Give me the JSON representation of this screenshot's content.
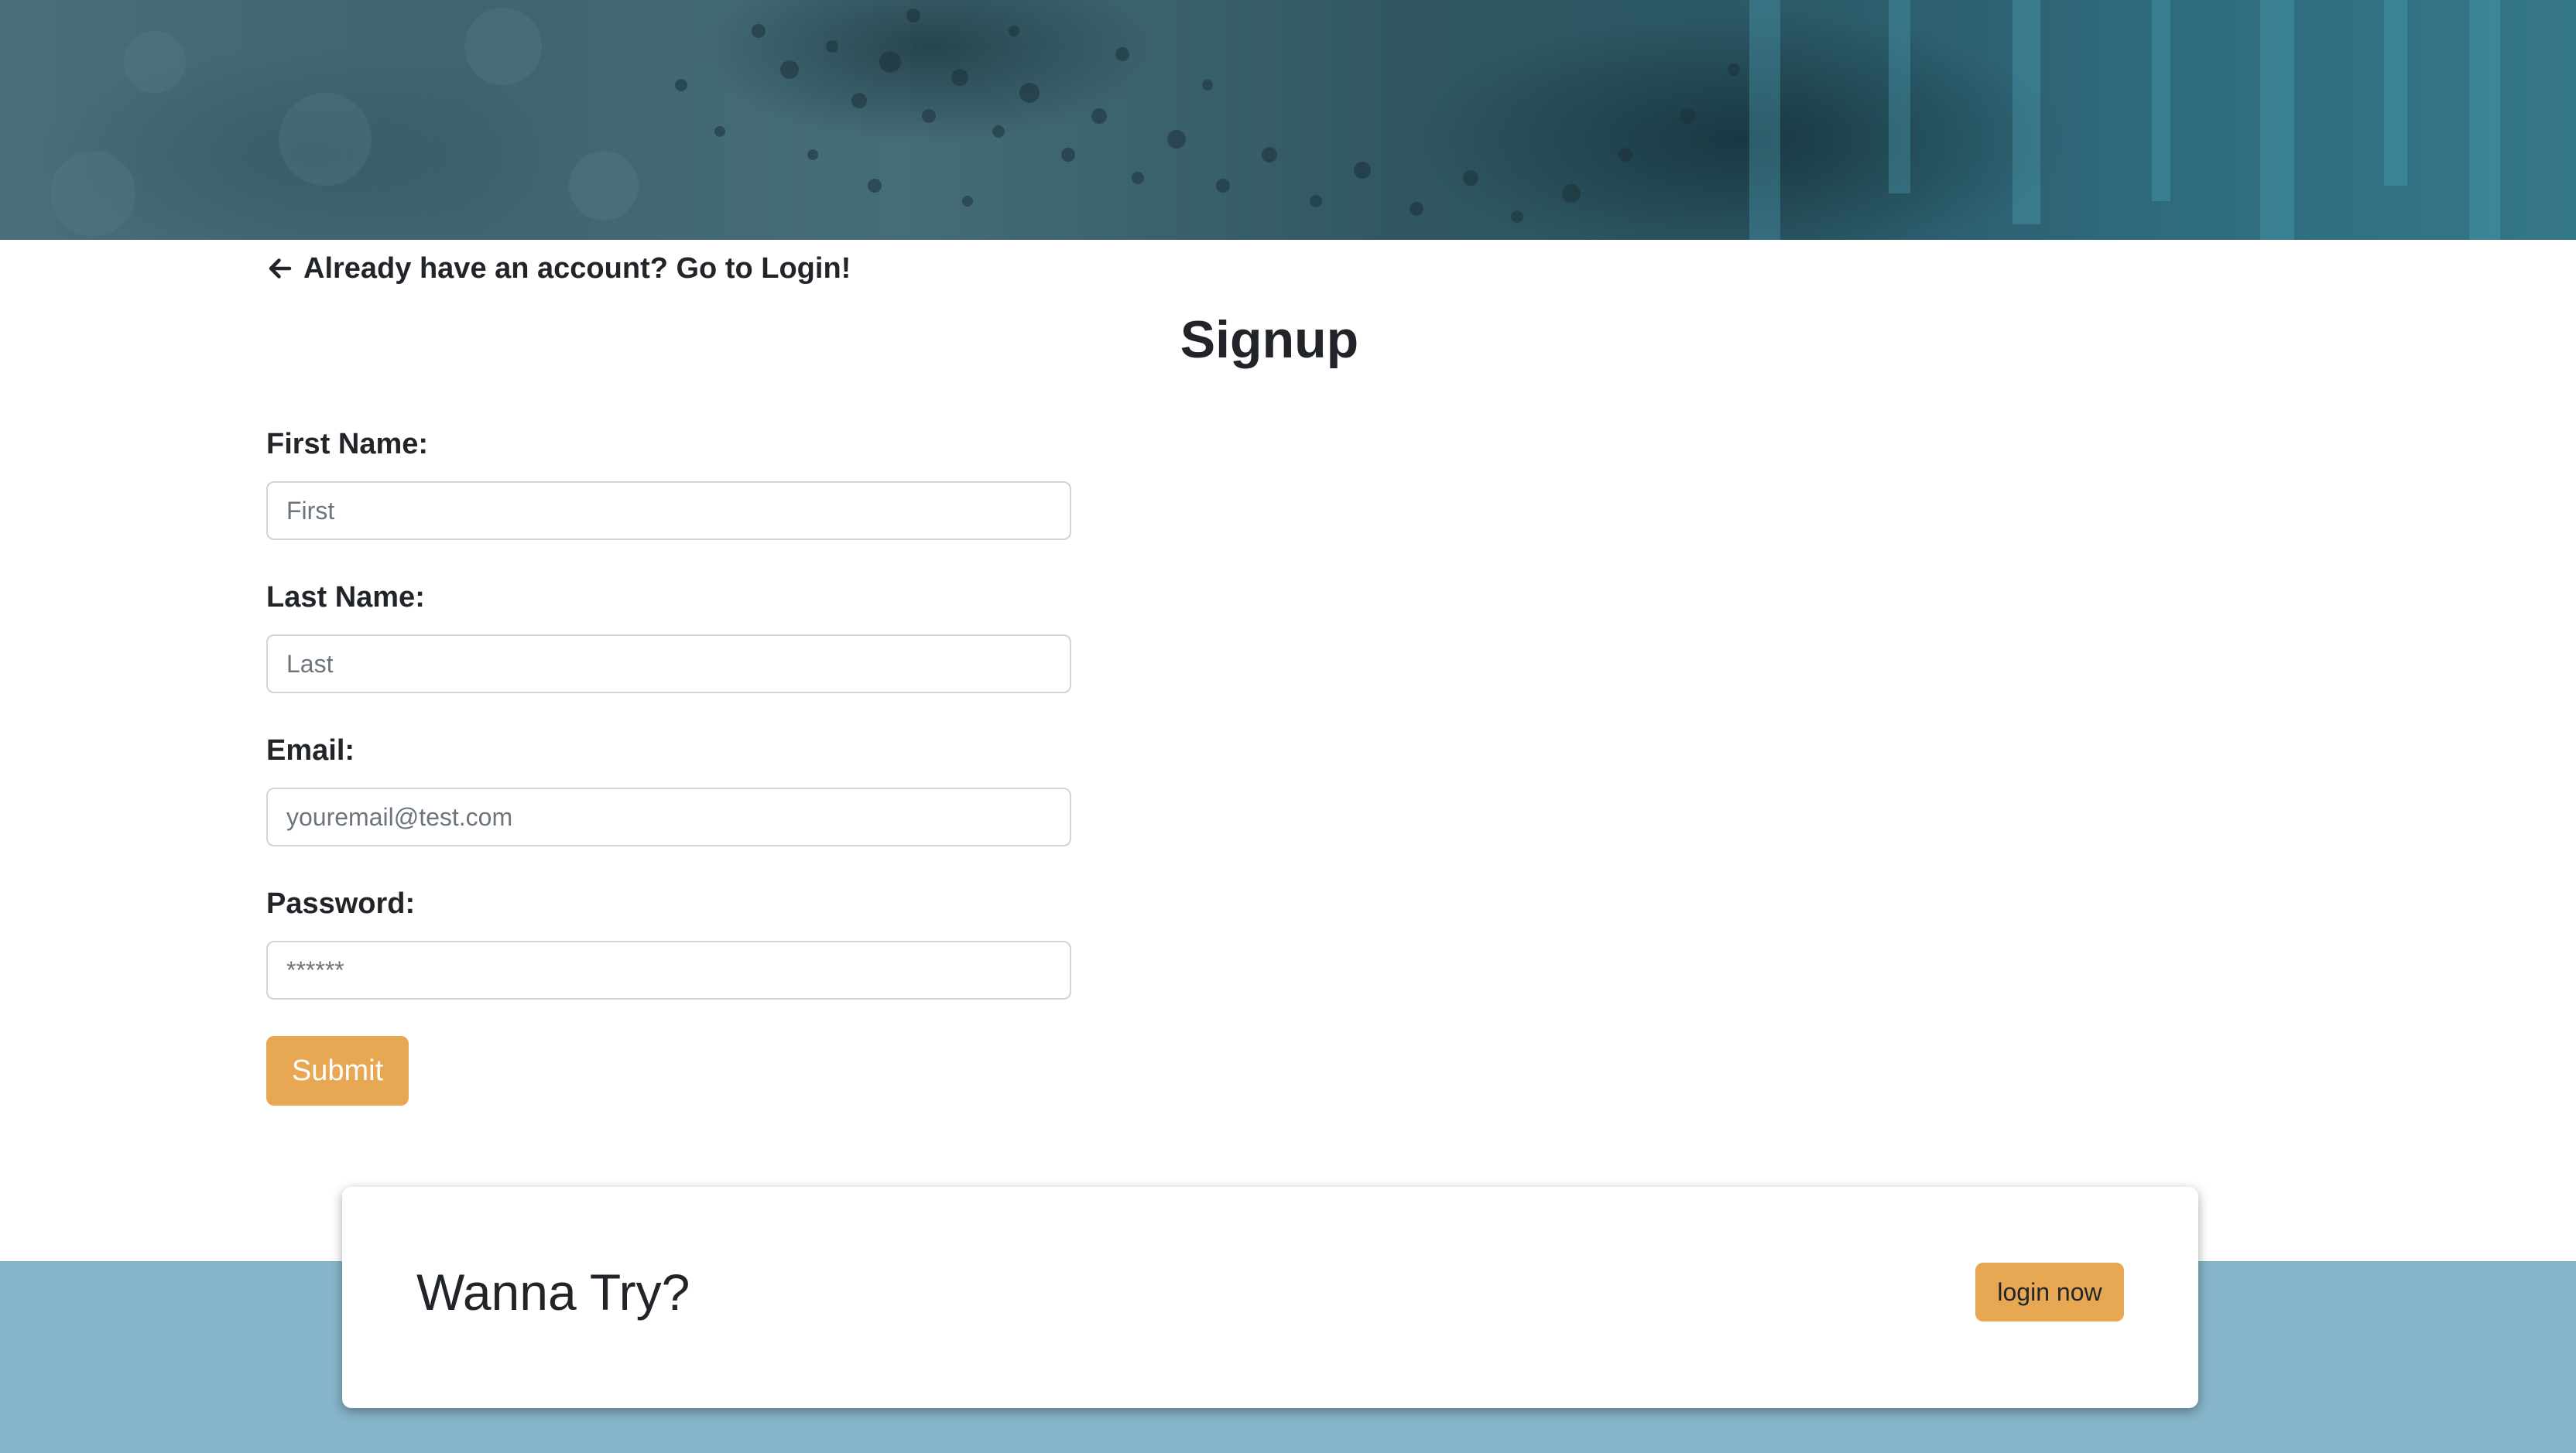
{
  "back_link": {
    "label": "Already have an account? Go to Login!",
    "icon": "arrow-left-icon"
  },
  "page_title": "Signup",
  "form": {
    "first_name": {
      "label": "First Name:",
      "placeholder": "First",
      "value": ""
    },
    "last_name": {
      "label": "Last Name:",
      "placeholder": "Last",
      "value": ""
    },
    "email": {
      "label": "Email:",
      "placeholder": "youremail@test.com",
      "value": ""
    },
    "password": {
      "label": "Password:",
      "placeholder": "******",
      "value": ""
    },
    "submit_label": "Submit"
  },
  "cta": {
    "title": "Wanna Try?",
    "button_label": "login now"
  },
  "colors": {
    "accent": "#e8a752",
    "footer_band": "#86b4c8",
    "text": "#212529",
    "input_border": "#ced4da"
  }
}
